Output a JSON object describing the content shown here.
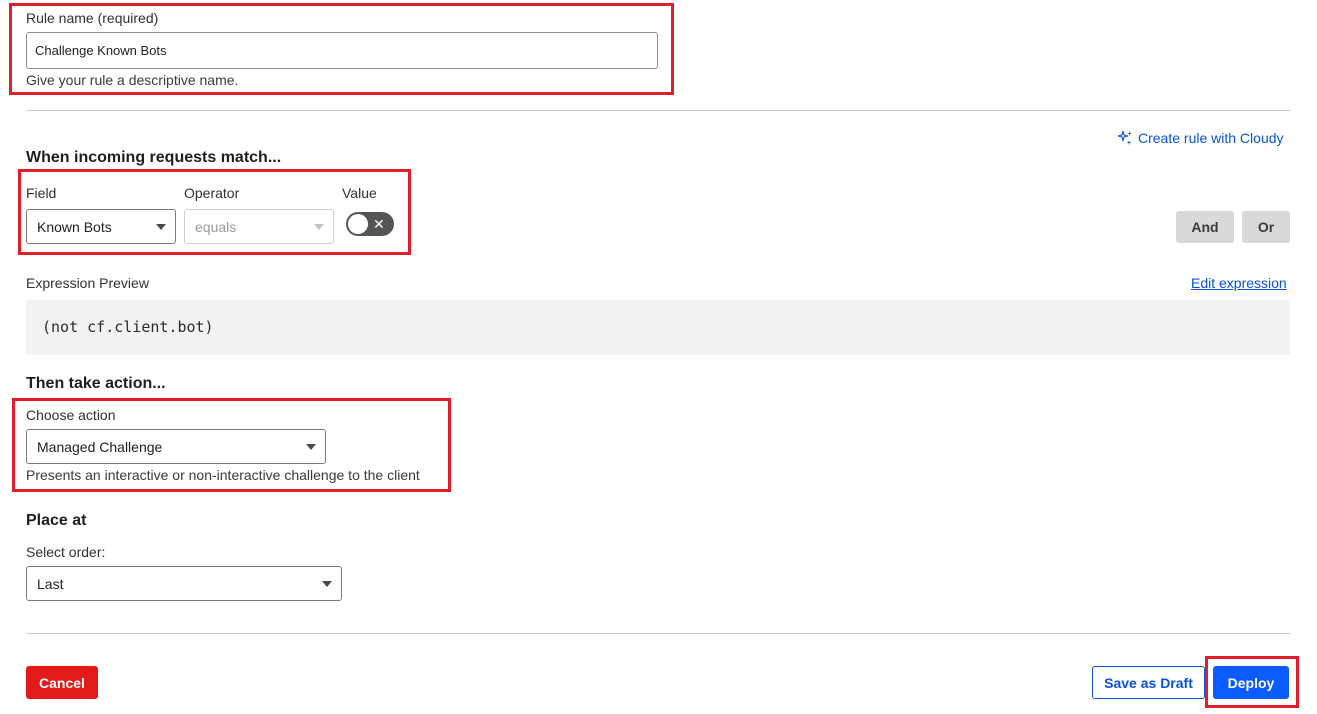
{
  "rule_name": {
    "label": "Rule name (required)",
    "value": "Challenge Known Bots",
    "hint": "Give your rule a descriptive name."
  },
  "cloudy_link": {
    "icon": "sparkle-icon",
    "label": "Create rule with Cloudy"
  },
  "match": {
    "heading": "When incoming requests match...",
    "field_label": "Field",
    "field_value": "Known Bots",
    "operator_label": "Operator",
    "operator_value": "equals",
    "value_label": "Value",
    "toggle_on": false,
    "and_label": "And",
    "or_label": "Or"
  },
  "expression": {
    "label": "Expression Preview",
    "edit_label": "Edit expression",
    "code": "(not cf.client.bot)"
  },
  "action": {
    "heading": "Then take action...",
    "label": "Choose action",
    "value": "Managed Challenge",
    "hint": "Presents an interactive or non-interactive challenge to the client"
  },
  "placement": {
    "heading": "Place at",
    "label": "Select order:",
    "value": "Last"
  },
  "footer": {
    "cancel_label": "Cancel",
    "draft_label": "Save as Draft",
    "deploy_label": "Deploy"
  },
  "colors": {
    "highlight": "#e11d2a",
    "primary": "#0a5cff",
    "danger": "#e31a1a",
    "link": "#0a53d6"
  }
}
